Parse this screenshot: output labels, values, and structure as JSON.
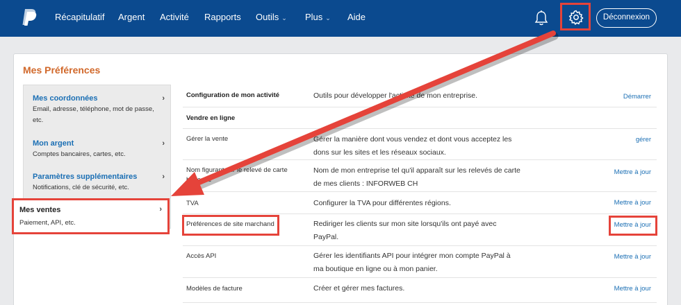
{
  "nav": {
    "items": [
      {
        "label": "Récapitulatif",
        "chevron": false
      },
      {
        "label": "Argent",
        "chevron": false
      },
      {
        "label": "Activité",
        "chevron": false
      },
      {
        "label": "Rapports",
        "chevron": false
      },
      {
        "label": "Outils",
        "chevron": true
      },
      {
        "label": "Plus",
        "chevron": true
      },
      {
        "label": "Aide",
        "chevron": false
      }
    ],
    "logout_label": "Déconnexion"
  },
  "page_title": "Mes Préférences",
  "sidebar": {
    "items": [
      {
        "title": "Mes coordonnées",
        "subtitle": "Email, adresse, téléphone, mot de passe, etc."
      },
      {
        "title": "Mon argent",
        "subtitle": "Comptes bancaires, cartes, etc."
      },
      {
        "title": "Paramètres supplémentaires",
        "subtitle": "Notifications, clé de sécurité, etc."
      },
      {
        "title": "Mes ventes",
        "subtitle": "Paiement, API, etc."
      }
    ]
  },
  "table": {
    "rows": [
      {
        "name": "Configuration de mon activité",
        "description": "Outils pour développer l'activité de mon entreprise.",
        "action": "Démarrer"
      },
      {
        "section": "Vendre en ligne"
      },
      {
        "name": "Gérer la vente",
        "description": "Gérer la manière dont vous vendez et dont vous acceptez les dons sur les sites et les réseaux sociaux.",
        "action": "gérer"
      },
      {
        "name": "Nom figurant sur le relevé de carte bancaire",
        "description": "Nom de mon entreprise tel qu'il apparaît sur les relevés de carte de mes clients : INFORWEB CH",
        "action": "Mettre à jour"
      },
      {
        "name": "TVA",
        "description": "Configurer la TVA pour différentes régions.",
        "action": "Mettre à jour"
      },
      {
        "name": "Préférences de site marchand",
        "description": "Rediriger les clients sur mon site lorsqu'ils ont payé avec PayPal.",
        "action": "Mettre à jour"
      },
      {
        "name": "Accès API",
        "description": "Gérer les identifiants API pour intégrer mon compte PayPal à ma boutique en ligne ou à mon panier.",
        "action": "Mettre à jour"
      },
      {
        "name": "Modèles de facture",
        "description": "Créer et gérer mes factures.",
        "action": "Mettre à jour"
      }
    ]
  },
  "colors": {
    "nav_bg": "#0b4a8f",
    "link": "#1b6fb4",
    "title_orange": "#d1682a",
    "highlight_red": "#e5433a"
  }
}
